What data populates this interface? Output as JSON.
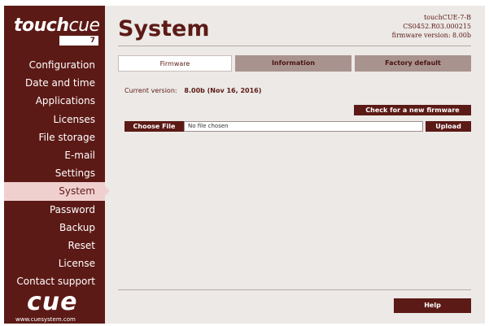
{
  "logo": {
    "text_bold": "touch",
    "text_thin": "cue",
    "badge": "7"
  },
  "nav": [
    {
      "label": "Configuration",
      "name": "nav-configuration"
    },
    {
      "label": "Date and time",
      "name": "nav-date-and-time"
    },
    {
      "label": "Applications",
      "name": "nav-applications"
    },
    {
      "label": "Licenses",
      "name": "nav-licenses"
    },
    {
      "label": "File storage",
      "name": "nav-file-storage"
    },
    {
      "label": "E-mail",
      "name": "nav-e-mail"
    },
    {
      "label": "Settings",
      "name": "nav-settings"
    },
    {
      "label": "System",
      "name": "nav-system",
      "active": true
    },
    {
      "label": "Password",
      "name": "nav-password"
    },
    {
      "label": "Backup",
      "name": "nav-backup"
    },
    {
      "label": "Reset",
      "name": "nav-reset"
    },
    {
      "label": "License",
      "name": "nav-license"
    },
    {
      "label": "Contact support",
      "name": "nav-contact-support"
    }
  ],
  "brand": {
    "logo": "cue",
    "url": "www.cuesystem.com"
  },
  "page": {
    "title": "System",
    "device_name": "touchCUE-7-B",
    "serial": "CS0452.R03.000215",
    "firmware_line": "firmware version: 8.00b"
  },
  "tabs": {
    "firmware": "Firmware",
    "information": "Information",
    "factory_default": "Factory default"
  },
  "firmware": {
    "current_label": "Current version:",
    "current_value": "8.00b (Nov 16, 2016)",
    "check_button": "Check for a new firmware",
    "choose_file": "Choose File",
    "no_file": "No file chosen",
    "upload_button": "Upload"
  },
  "footer": {
    "help_button": "Help"
  },
  "colors": {
    "accent": "#5c1a16",
    "tab_inactive": "#a9938f",
    "nav_active": "#f0d0cf",
    "panel_bg": "#ece9e6"
  }
}
